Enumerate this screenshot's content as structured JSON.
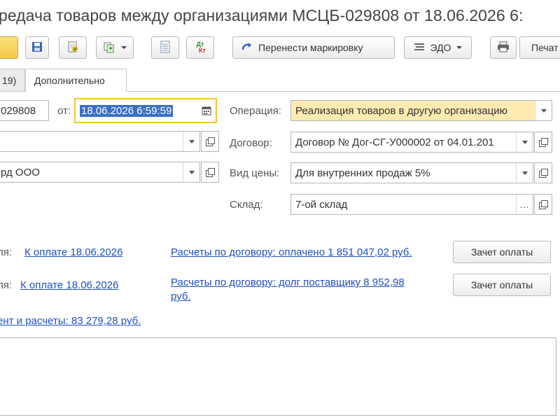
{
  "window": {
    "title": "редача товаров между организациями МСЦБ-029808 от 18.06.2026 6:"
  },
  "toolbar": {
    "move_marking_label": "Перенести маркировку",
    "edo_label": "ЭДО",
    "print_label": "Печат",
    "dtkt_top": "Дт",
    "dtkt_bottom": "Кт"
  },
  "tabs": [
    {
      "label": "19)"
    },
    {
      "label": "Дополнительно"
    }
  ],
  "header": {
    "number_value": "029808",
    "date_label": "от:",
    "date_value": "18.06.2026  6:59:59"
  },
  "left": {
    "org_value": "",
    "counterparty_value": "рд ООО"
  },
  "right": {
    "operation_label": "Операция:",
    "operation_value": "Реализация товаров в другую организацию",
    "contract_label": "Договор:",
    "contract_value": "Договор № Дог-СГ-У000002 от 04.01.201",
    "price_type_label": "Вид цены:",
    "price_type_value": "Для внутренних продаж 5%",
    "warehouse_label": "Склад:",
    "warehouse_value": "7-ой склад"
  },
  "payment": {
    "row1_prefix": "ля:",
    "row1_link": "К оплате 18.06.2026",
    "row1_settlement": "Расчеты по договору: оплачено 1 851 047,02 руб.",
    "row1_button": "Зачет оплаты",
    "row2_prefix": "ля:",
    "row2_link": "К оплате 18.06.2026",
    "row2_settlement_line1": "Расчеты по договору: долг поставщику 8 952,98",
    "row2_settlement_line2": "руб.",
    "row2_button": "Зачет оплаты",
    "total_link": "ент и расчеты: 83 279,28 руб."
  },
  "colors": {
    "accent_yellow": "#f2c84b",
    "link_blue": "#1f4fbd",
    "highlight_field": "#fdeab0",
    "selection": "#3970c4"
  }
}
